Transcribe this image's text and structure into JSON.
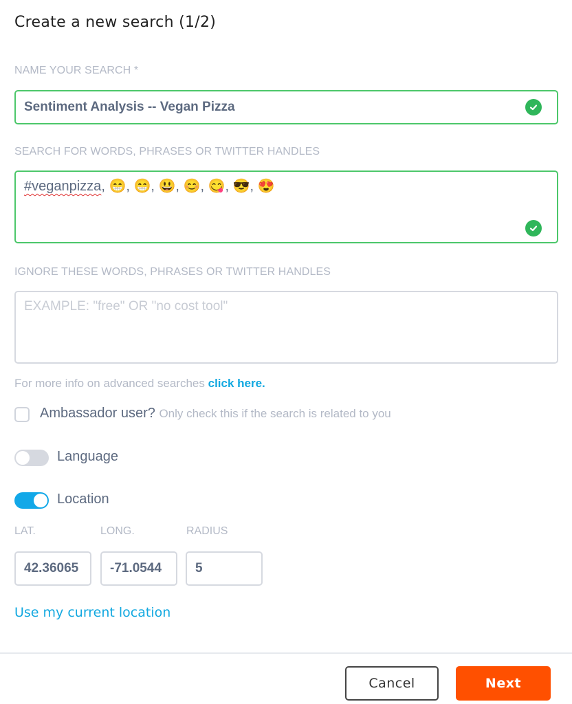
{
  "dialog": {
    "title": "Create a new search (1/2)"
  },
  "name_field": {
    "label": "NAME YOUR SEARCH *",
    "value": "Sentiment  Analysis -- Vegan Pizza",
    "valid": true
  },
  "search_field": {
    "label": "SEARCH FOR WORDS, PHRASES OR TWITTER HANDLES",
    "hashtag": "#veganpizza",
    "emojis": [
      "😁",
      "😁",
      "😃",
      "😊",
      "😋",
      "😎",
      "😍"
    ],
    "separator": ", ",
    "valid": true
  },
  "ignore_field": {
    "label": "IGNORE THESE WORDS, PHRASES OR TWITTER HANDLES",
    "placeholder": "EXAMPLE: \"free\" OR \"no cost tool\"",
    "value": ""
  },
  "info": {
    "text": "For more info on advanced searches ",
    "link": "click here."
  },
  "ambassador": {
    "label": "Ambassador user?",
    "hint": "Only check this if the search is related to you",
    "checked": false
  },
  "language_toggle": {
    "label": "Language",
    "on": false
  },
  "location_toggle": {
    "label": "Location",
    "on": true
  },
  "location": {
    "lat_label": "LAT.",
    "long_label": "LONG.",
    "radius_label": "RADIUS",
    "lat_value": "42.36065",
    "long_value": "-71.0544",
    "radius_value": "5",
    "use_current_link": "Use my current location"
  },
  "footer": {
    "cancel_label": "Cancel",
    "next_label": "Next"
  },
  "colors": {
    "valid_border": "#4cc76a",
    "check_green": "#2fb65a",
    "accent_blue": "#12a8e0",
    "next_orange": "#ff5000"
  }
}
